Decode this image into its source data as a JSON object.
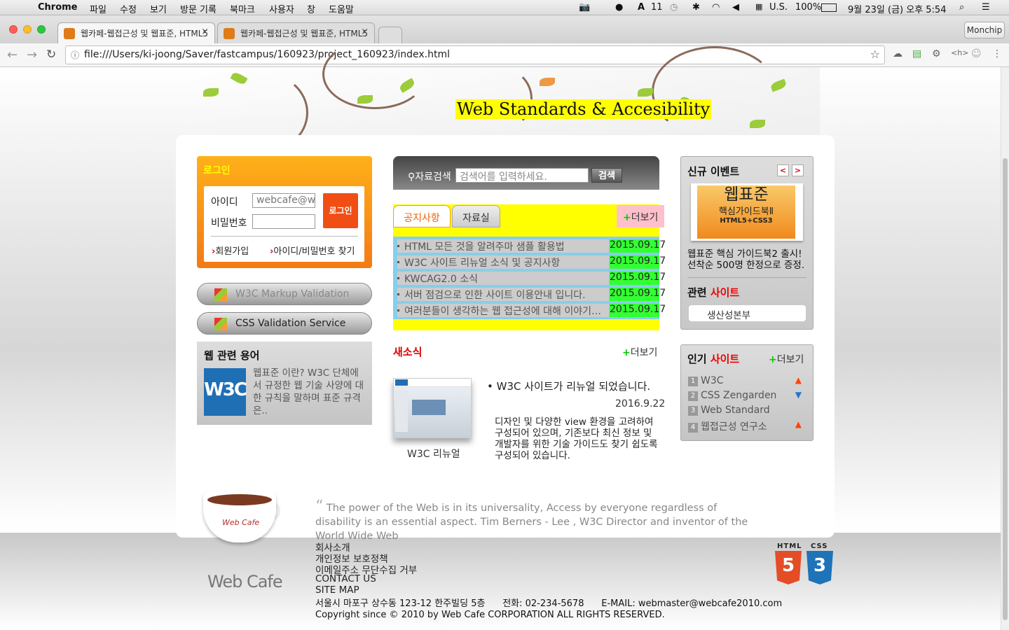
{
  "menubar": {
    "app": "Chrome",
    "items": [
      "파일",
      "수정",
      "보기",
      "방문 기록",
      "북마크",
      "사용자",
      "창",
      "도움말"
    ],
    "status": {
      "counter": "11",
      "input_source": "U.S.",
      "battery": "100%",
      "datetime": "9월 23일 (금) 오후 5:54"
    }
  },
  "browser": {
    "tabs": [
      {
        "title": "웹카페-웹접근성 및 웹표준, HTML5",
        "close": "×"
      },
      {
        "title": "웹카페-웹접근성 및 웹표준, HTML5",
        "close": "×"
      }
    ],
    "profile": "Monchip",
    "url": "file:///Users/ki-joong/Saver/fastcampus/160923/project_160923/index.html"
  },
  "page": {
    "title": "Web Standards & Accesibility",
    "login": {
      "heading": "로그인",
      "id_label": "아이디",
      "id_value": "webcafe@webcafe.com",
      "pw_label": "비밀번호",
      "button": "로그인",
      "signup": "회원가입",
      "find": "아이디/비밀번호 찾기"
    },
    "validators": [
      "W3C Markup Validation",
      "CSS Validation Service"
    ],
    "terms": {
      "heading": "웹 관련 용어",
      "logo": "W3C",
      "text": "웹표준 이란? W3C 단체에서 규정한 웹 기술 사양에 대한 규칙을 말하며 표준 규격은.."
    },
    "search": {
      "label": "자료검색",
      "placeholder": "검색어를 입력하세요.",
      "button": "검색"
    },
    "notice": {
      "tabs": [
        "공지사항",
        "자료실"
      ],
      "more": "더보기",
      "items": [
        {
          "title": "HTML 모든 것을 알려주마 샘플 활용법",
          "date": "2015.09.17"
        },
        {
          "title": "W3C 사이트 리뉴얼 소식 및 공지사항",
          "date": "2015.09.17"
        },
        {
          "title": "KWCAG2.0 소식",
          "date": "2015.09.17"
        },
        {
          "title": "서버 점검으로 인한 사이트 이용안내 입니다.",
          "date": "2015.09.17"
        },
        {
          "title": "여러분들이 생각하는 웹 접근성에 대해 이야기를 나눠봅시다",
          "date": "2015.09.17"
        }
      ]
    },
    "news": {
      "heading": "새소식",
      "more": "더보기",
      "caption": "W3C 리뉴얼",
      "title": "W3C 사이트가 리뉴얼 되었습니다.",
      "date": "2016.9.22",
      "body": "디자인 및 다양한 view 환경을 고려하여 구성되어 있으며, 기존보다 최신 정보 및 개발자를 위한 기술 가이드도 찾기 쉽도록 구성되어 있습니다."
    },
    "event": {
      "heading": "신규 이벤트",
      "prev": "<",
      "next": ">",
      "book_title": "웹표준",
      "book_sub": "핵심가이드북Ⅱ",
      "book_tag": "HTML5+CSS3",
      "text": "웹표준 핵심 가이드북2 출시! 선착순 500명 한정으로 증정."
    },
    "related": {
      "prefix": "관련 ",
      "accent": "사이트",
      "selected": "생산성본부"
    },
    "popular": {
      "prefix": "인기 ",
      "accent": "사이트",
      "more": "더보기",
      "items": [
        {
          "rank": "1",
          "name": "W3C",
          "trend": "up"
        },
        {
          "rank": "2",
          "name": "CSS Zengarden",
          "trend": "down"
        },
        {
          "rank": "3",
          "name": "Web Standard",
          "trend": "same"
        },
        {
          "rank": "4",
          "name": "웹접근성 연구소",
          "trend": "up"
        }
      ]
    },
    "footer": {
      "cup_brand": "Web Cafe",
      "logo": "Web Cafe",
      "quote": "The power of the Web is in its universality, Access by everyone regardless of disability is an essential aspect. Tim Berners - Lee , W3C Director and inventor of the World Wide Web",
      "links": [
        "회사소개",
        "개인정보 보호정책",
        "이메일주소 무단수집 거부",
        "CONTACT US",
        "SITE MAP"
      ],
      "address": "서울시 마포구 상수동 123-12 한주빌딩 5층      전화: 02-234-5678      E-MAIL: webmaster@webcafe2010.com",
      "copyright": "Copyright since © 2010 by Web Cafe CORPORATION ALL RIGHTS RESERVED.",
      "badges": [
        {
          "label": "HTML",
          "num": "5",
          "color": "#e44d26"
        },
        {
          "label": "CSS",
          "num": "3",
          "color": "#1f73b8"
        }
      ]
    }
  }
}
